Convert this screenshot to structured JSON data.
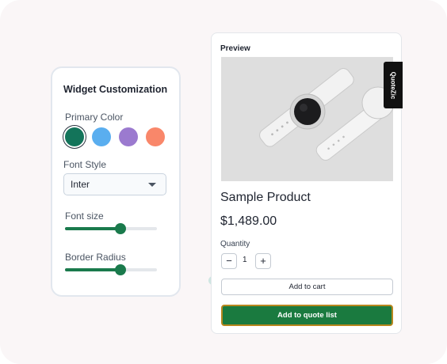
{
  "customization": {
    "title": "Widget Customization",
    "primary_color_label": "Primary Color",
    "colors": [
      {
        "name": "green",
        "hex": "#13745a",
        "selected": true
      },
      {
        "name": "blue",
        "hex": "#5aaeef",
        "selected": false
      },
      {
        "name": "purple",
        "hex": "#9b7acf",
        "selected": false
      },
      {
        "name": "orange",
        "hex": "#f9876a",
        "selected": false
      }
    ],
    "font_style_label": "Font Style",
    "font_style_value": "Inter",
    "font_size_label": "Font size",
    "font_size_level": 0.6,
    "border_radius_label": "Border Radius",
    "border_radius_level": 0.6
  },
  "preview": {
    "label": "Preview",
    "quote_tab": "QuoteZic",
    "product_title": "Sample Product",
    "price": "$1,489.00",
    "quantity_label": "Quantity",
    "quantity": "1",
    "minus": "−",
    "plus": "+",
    "add_to_cart": "Add to cart",
    "add_to_quote": "Add to quote list",
    "accent_color": "#1a7a3f"
  }
}
